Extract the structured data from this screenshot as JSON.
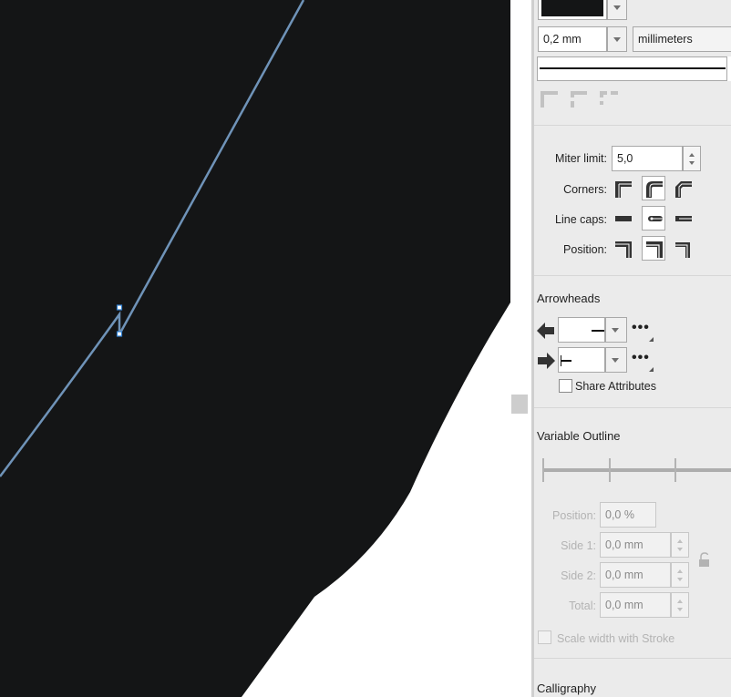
{
  "outline": {
    "width_value": "0,2 mm",
    "units_value": "millimeters"
  },
  "join": {
    "miter_label": "Miter limit:",
    "miter_value": "5,0",
    "corners_label": "Corners:",
    "linecaps_label": "Line caps:",
    "position_label": "Position:"
  },
  "arrowheads": {
    "title": "Arrowheads",
    "share_label": "Share Attributes"
  },
  "variable_outline": {
    "title": "Variable Outline",
    "position_label": "Position:",
    "position_value": "0,0 %",
    "side1_label": "Side 1:",
    "side1_value": "0,0 mm",
    "side2_label": "Side 2:",
    "side2_value": "0,0 mm",
    "total_label": "Total:",
    "total_value": "0,0 mm",
    "scale_label": "Scale width with Stroke"
  },
  "calligraphy": {
    "title": "Calligraphy"
  },
  "colors": {
    "shape_fill": "#141516",
    "path_stroke": "#6f93b8",
    "panel_bg": "#ebebeb"
  }
}
